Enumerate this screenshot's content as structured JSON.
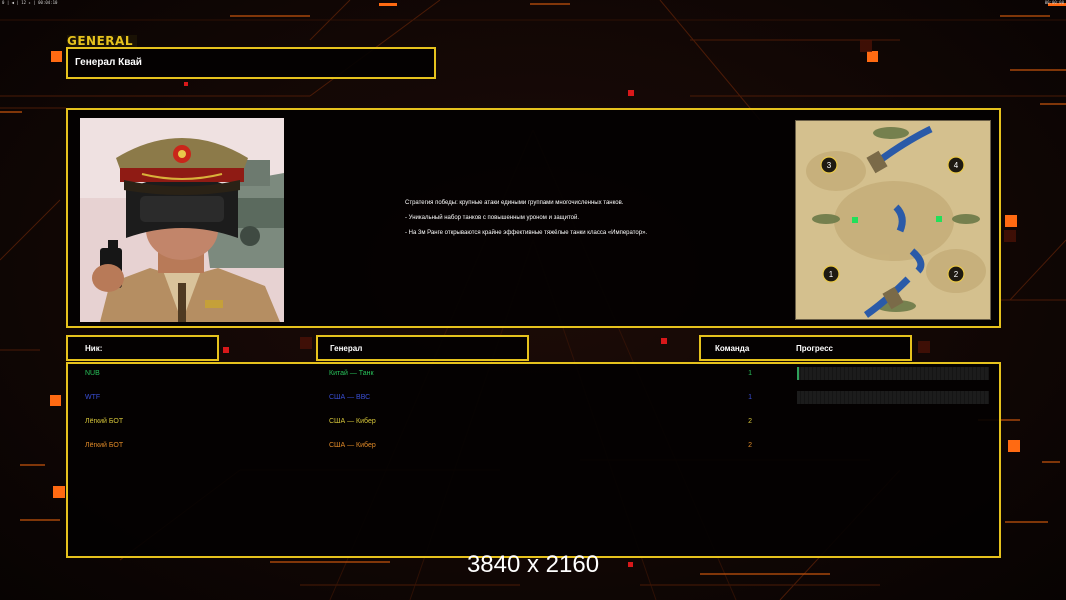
{
  "window": {
    "status_left": "0 | ◀ | 12 ▸ | 00:04:10",
    "status_right": "00:00:00"
  },
  "general": {
    "tab_label": "GENERAL",
    "name": "Генерал Квай",
    "description": [
      "Стратегия победы: крупные атаки едиными группами многочисленных танков.",
      "- Уникальный набор танков с повышенным уроном и защитой.",
      "- На 3м Ранге открываются крайне эффективные тяжёлые танки класса «Император»."
    ]
  },
  "minimap": {
    "start_positions": [
      "3",
      "4",
      "1",
      "2"
    ]
  },
  "table": {
    "headers": {
      "nick": "Ник:",
      "general": "Генерал",
      "team": "Команда",
      "progress": "Прогресс"
    },
    "rows": [
      {
        "nick": "NUB",
        "general": "Китай — Танк",
        "team": "1",
        "color": "#28c25a",
        "progress": 0.01
      },
      {
        "nick": "WTF",
        "general": "США — ВВС",
        "team": "1",
        "color": "#3a4fd6",
        "progress": 0
      },
      {
        "nick": "Лёгкий БОТ",
        "general": "США — Кибер",
        "team": "2",
        "color": "#d6c63a",
        "progress": null
      },
      {
        "nick": "Лёгкий БОТ",
        "general": "США — Кибер",
        "team": "2",
        "color": "#e08a28",
        "progress": null
      }
    ]
  },
  "overlay": {
    "resolution": "3840 x 2160"
  },
  "colors": {
    "accent": "#e6c21d",
    "background": "#120705",
    "glow": "#ff6a12"
  }
}
